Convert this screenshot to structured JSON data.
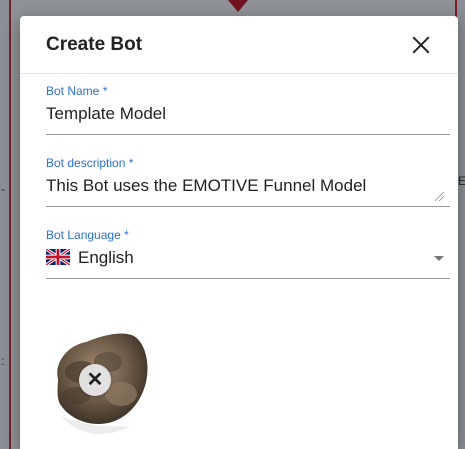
{
  "dialog": {
    "title": "Create Bot",
    "close_icon": "close-icon"
  },
  "fields": {
    "bot_name": {
      "label": "Bot Name *",
      "value": "Template Model"
    },
    "bot_description": {
      "label": "Bot description *",
      "value": "This Bot uses the EMOTIVE Funnel Model"
    },
    "bot_language": {
      "label": "Bot Language *",
      "value": "English",
      "flag_icon": "uk-flag-icon"
    }
  },
  "avatar": {
    "remove_icon": "remove-image-icon",
    "remove_symbol": "✕"
  },
  "background": {
    "right_edge_text": "E",
    "left_edge_text_1": "-",
    "left_edge_text_2": ":"
  },
  "colors": {
    "accent": "#2a6fdb",
    "frame": "#7a1f2b"
  }
}
